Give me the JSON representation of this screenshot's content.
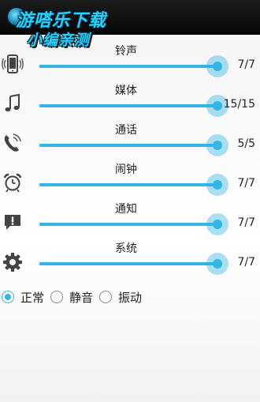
{
  "watermark": {
    "line1": "游嗒乐下载",
    "line2": "小编亲测"
  },
  "rows": [
    {
      "label": "铃声",
      "value_text": "7/7",
      "fraction": 1.0,
      "icon": "ringtone-phone-icon"
    },
    {
      "label": "媒体",
      "value_text": "15/15",
      "fraction": 1.0,
      "icon": "music-note-icon"
    },
    {
      "label": "通话",
      "value_text": "5/5",
      "fraction": 1.0,
      "icon": "phone-call-icon"
    },
    {
      "label": "闹钟",
      "value_text": "7/7",
      "fraction": 1.0,
      "icon": "alarm-clock-icon"
    },
    {
      "label": "通知",
      "value_text": "7/7",
      "fraction": 1.0,
      "icon": "notification-icon"
    },
    {
      "label": "系统",
      "value_text": "7/7",
      "fraction": 1.0,
      "icon": "gear-icon"
    }
  ],
  "modes": {
    "selected": "正常",
    "options": [
      "正常",
      "静音",
      "振动"
    ]
  },
  "colors": {
    "accent": "#33b5e5",
    "topbar": "#0b0b0b",
    "watermark": "#28d1ff"
  }
}
